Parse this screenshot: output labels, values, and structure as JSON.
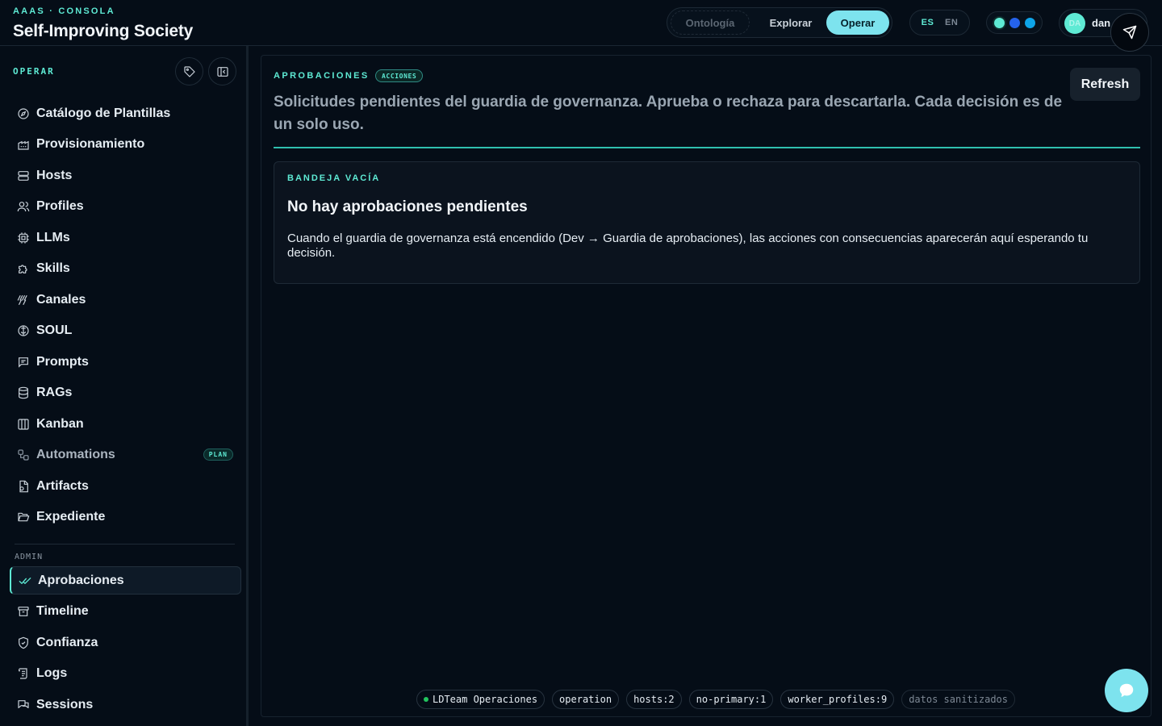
{
  "header": {
    "kicker": "AAAS · CONSOLA",
    "title": "Self-Improving Society",
    "modes": [
      {
        "label": "Ontología",
        "state": "disabled"
      },
      {
        "label": "Explorar",
        "state": "inactive"
      },
      {
        "label": "Operar",
        "state": "active"
      }
    ],
    "languages": [
      {
        "label": "ES",
        "state": "active"
      },
      {
        "label": "EN",
        "state": "inactive"
      }
    ],
    "theme_dots": [
      "#5eead4",
      "#2563eb",
      "#0ea5e9"
    ],
    "user": {
      "initials": "DA",
      "name": "dan"
    }
  },
  "colors": {
    "accent": "#5eead4",
    "mode_active": "#7de3ee",
    "background": "#050d17"
  },
  "sidebar": {
    "heading": "OPERAR",
    "tools": [
      "tag-icon",
      "collapse-sidebar-icon"
    ],
    "items": [
      {
        "label": "Catálogo de Plantillas",
        "icon": "compass-icon"
      },
      {
        "label": "Provisionamiento",
        "icon": "factory-icon"
      },
      {
        "label": "Hosts",
        "icon": "server-icon"
      },
      {
        "label": "Profiles",
        "icon": "users-icon"
      },
      {
        "label": "LLMs",
        "icon": "cpu-icon"
      },
      {
        "label": "Skills",
        "icon": "puzzle-icon"
      },
      {
        "label": "Canales",
        "icon": "antenna-icon"
      },
      {
        "label": "SOUL",
        "icon": "brain-icon"
      },
      {
        "label": "Prompts",
        "icon": "message-square-icon"
      },
      {
        "label": "RAGs",
        "icon": "database-icon"
      },
      {
        "label": "Kanban",
        "icon": "kanban-icon"
      },
      {
        "label": "Automations",
        "icon": "workflow-icon",
        "badge": "PLAN",
        "muted": true
      },
      {
        "label": "Artifacts",
        "icon": "file-icon"
      },
      {
        "label": "Expediente",
        "icon": "folder-open-icon"
      }
    ],
    "admin_heading": "ADMIN",
    "admin_items": [
      {
        "label": "Aprobaciones",
        "icon": "check-check-icon",
        "active": true
      },
      {
        "label": "Timeline",
        "icon": "archive-icon"
      },
      {
        "label": "Confianza",
        "icon": "shield-check-icon"
      },
      {
        "label": "Logs",
        "icon": "scroll-icon"
      },
      {
        "label": "Sessions",
        "icon": "messages-icon"
      }
    ]
  },
  "main": {
    "kicker": "APROBACIONES",
    "badge": "ACCIONES",
    "description": "Solicitudes pendientes del guardia de governanza. Aprueba o rechaza para descartarla. Cada decisión es de un solo uso.",
    "refresh_label": "Refresh",
    "empty": {
      "kicker": "BANDEJA VACÍA",
      "title": "No hay aprobaciones pendientes",
      "text": "Cuando el guardia de governanza está encendido (Dev → Guardia de aprobaciones), las acciones con consecuencias aparecerán aquí esperando tu decisión."
    }
  },
  "status_bar": [
    {
      "label": "LDTeam Operaciones",
      "dot": "#22c55e"
    },
    {
      "label": "operation"
    },
    {
      "label": "hosts:2"
    },
    {
      "label": "no-primary:1"
    },
    {
      "label": "worker_profiles:9"
    },
    {
      "label": "datos sanitizados",
      "dim": true
    }
  ]
}
